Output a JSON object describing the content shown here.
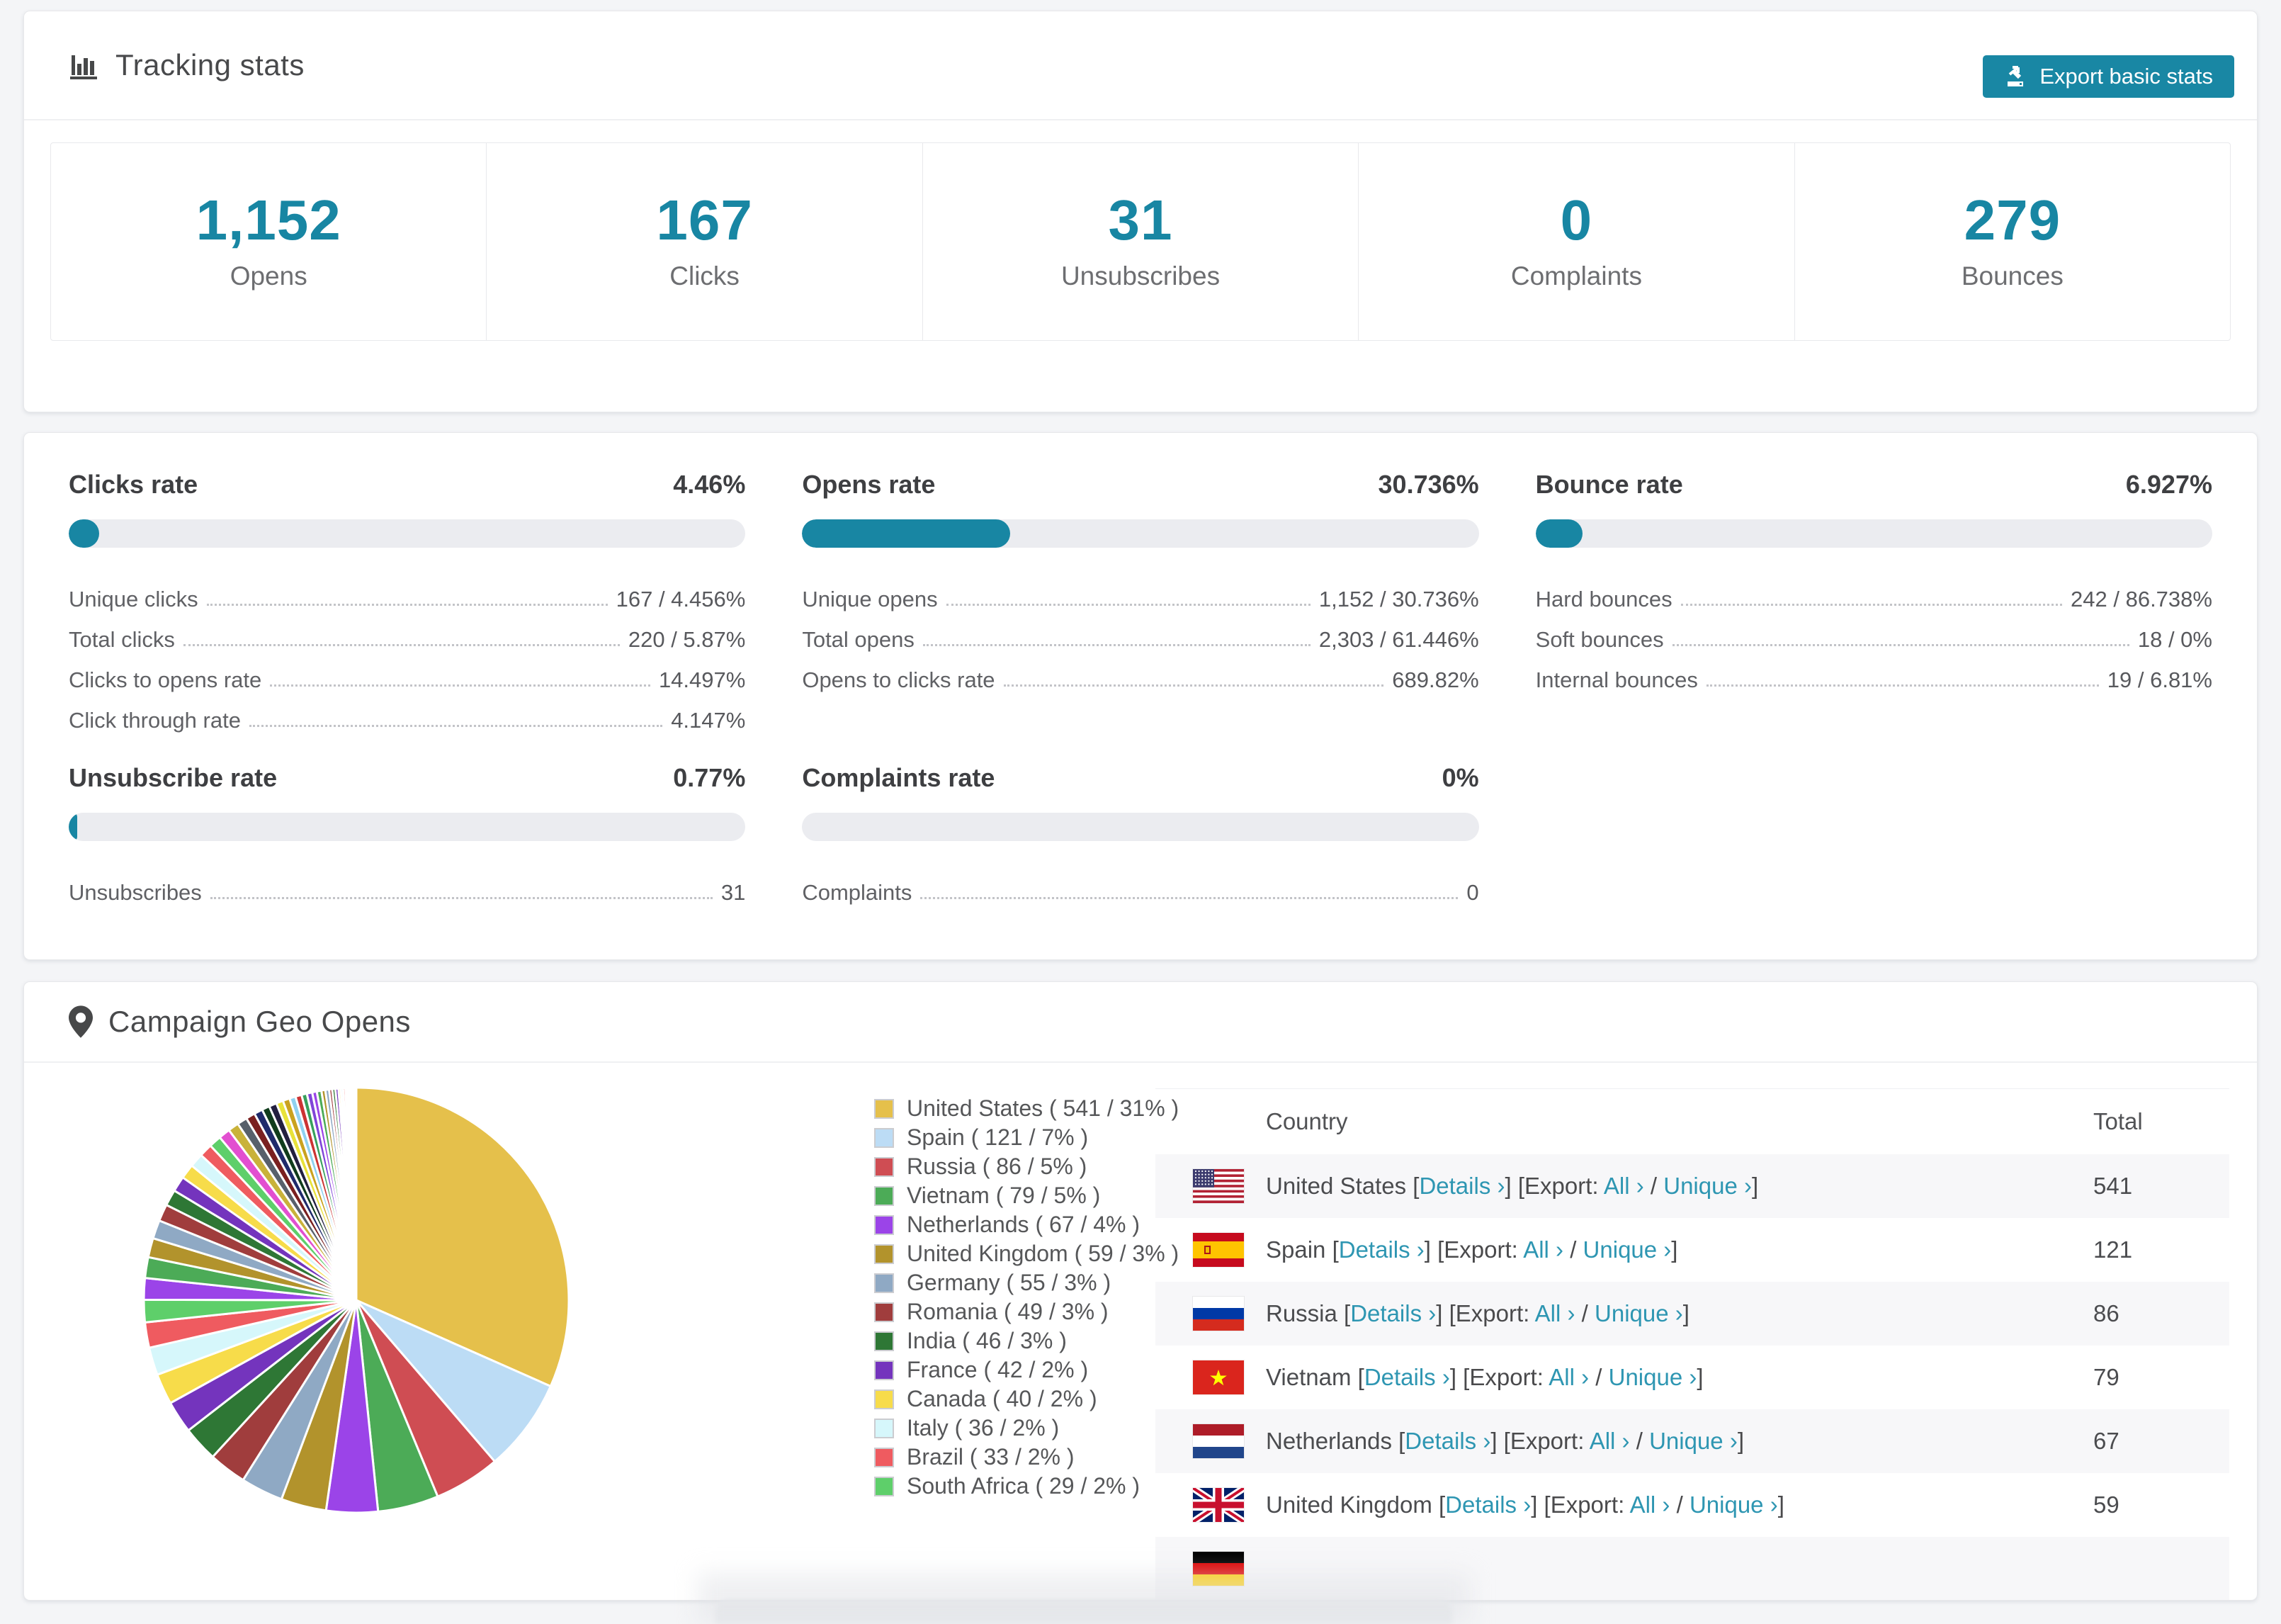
{
  "accent_color": "#1886a3",
  "link_color": "#2e96b2",
  "tracking": {
    "title": "Tracking stats",
    "icon": "bar-chart-icon",
    "export_button": "Export basic stats",
    "stats": [
      {
        "value": "1,152",
        "label": "Opens"
      },
      {
        "value": "167",
        "label": "Clicks"
      },
      {
        "value": "31",
        "label": "Unsubscribes"
      },
      {
        "value": "0",
        "label": "Complaints"
      },
      {
        "value": "279",
        "label": "Bounces"
      }
    ]
  },
  "rates": {
    "blocks": [
      {
        "title": "Clicks rate",
        "value": "4.46%",
        "bar_pct": 4.46,
        "rows": [
          [
            "Unique clicks",
            "167 / 4.456%"
          ],
          [
            "Total clicks",
            "220 / 5.87%"
          ],
          [
            "Clicks to opens rate",
            "14.497%"
          ],
          [
            "Click through rate",
            "4.147%"
          ]
        ]
      },
      {
        "title": "Opens rate",
        "value": "30.736%",
        "bar_pct": 30.736,
        "rows": [
          [
            "Unique opens",
            "1,152 / 30.736%"
          ],
          [
            "Total opens",
            "2,303 / 61.446%"
          ],
          [
            "Opens to clicks rate",
            "689.82%"
          ]
        ]
      },
      {
        "title": "Bounce rate",
        "value": "6.927%",
        "bar_pct": 6.927,
        "rows": [
          [
            "Hard bounces",
            "242 / 86.738%"
          ],
          [
            "Soft bounces",
            "18 / 0%"
          ],
          [
            "Internal bounces",
            "19 / 6.81%"
          ]
        ]
      },
      {
        "title": "Unsubscribe rate",
        "value": "0.77%",
        "bar_pct": 0.77,
        "rows": [
          [
            "Unsubscribes",
            "31"
          ]
        ]
      },
      {
        "title": "Complaints rate",
        "value": "0%",
        "bar_pct": 0,
        "rows": [
          [
            "Complaints",
            "0"
          ]
        ]
      }
    ]
  },
  "geo": {
    "title": "Campaign Geo Opens",
    "icon": "map-pin-icon",
    "table_headers": {
      "country": "Country",
      "total": "Total"
    },
    "link_labels": {
      "open_bracket": "[",
      "close_bracket": "]",
      "details": "Details ›",
      "export_prefix": "[Export:",
      "all": "All ›",
      "slash": "/",
      "unique": "Unique ›"
    },
    "rows": [
      {
        "country": "United States",
        "flag": "us",
        "total": "541"
      },
      {
        "country": "Spain",
        "flag": "es",
        "total": "121"
      },
      {
        "country": "Russia",
        "flag": "ru",
        "total": "86"
      },
      {
        "country": "Vietnam",
        "flag": "vn",
        "total": "79"
      },
      {
        "country": "Netherlands",
        "flag": "nl",
        "total": "67"
      },
      {
        "country": "United Kingdom",
        "flag": "gb",
        "total": "59"
      },
      {
        "country": "",
        "flag": "de",
        "total": "",
        "partial": true
      }
    ]
  },
  "chart_data": {
    "type": "pie",
    "title": "Campaign Geo Opens",
    "legend_position": "right",
    "start_angle_deg": 0,
    "direction": "clockwise",
    "series": [
      {
        "name": "United States",
        "value": 541,
        "pct": "31%",
        "color": "#e5c04b"
      },
      {
        "name": "Spain",
        "value": 121,
        "pct": "7%",
        "color": "#bcdcf5"
      },
      {
        "name": "Russia",
        "value": 86,
        "pct": "5%",
        "color": "#cf4d53"
      },
      {
        "name": "Vietnam",
        "value": 79,
        "pct": "5%",
        "color": "#4cab57"
      },
      {
        "name": "Netherlands",
        "value": 67,
        "pct": "4%",
        "color": "#9b44e8"
      },
      {
        "name": "United Kingdom",
        "value": 59,
        "pct": "3%",
        "color": "#b2932c"
      },
      {
        "name": "Germany",
        "value": 55,
        "pct": "3%",
        "color": "#8fa9c4"
      },
      {
        "name": "Romania",
        "value": 49,
        "pct": "3%",
        "color": "#a03d3d"
      },
      {
        "name": "India",
        "value": 46,
        "pct": "3%",
        "color": "#2e7735"
      },
      {
        "name": "France",
        "value": 42,
        "pct": "2%",
        "color": "#7434bd"
      },
      {
        "name": "Canada",
        "value": 40,
        "pct": "2%",
        "color": "#f7dc4a"
      },
      {
        "name": "Italy",
        "value": 36,
        "pct": "2%",
        "color": "#d6f7fb"
      },
      {
        "name": "Brazil",
        "value": 33,
        "pct": "2%",
        "color": "#ef5b60"
      },
      {
        "name": "South Africa",
        "value": 29,
        "pct": "2%",
        "color": "#5ecf6a"
      }
    ],
    "others": {
      "note": "remaining unlabeled countries shown as thin unlabeled slices",
      "values": [
        28,
        27,
        25,
        24,
        22,
        21,
        20,
        19,
        18,
        17,
        16,
        15,
        14,
        13,
        12,
        11,
        10,
        10,
        9,
        9,
        8,
        8,
        7,
        7,
        6,
        6,
        5,
        5,
        4,
        4,
        4,
        3,
        3,
        3,
        2,
        2,
        2,
        2,
        1,
        1,
        1,
        1,
        1,
        1
      ],
      "palette": [
        "#9b44e8",
        "#4cab57",
        "#b2932c",
        "#8fa9c4",
        "#a03d3d",
        "#2e7735",
        "#7434bd",
        "#f7dc4a",
        "#d6f7fb",
        "#ef5b60",
        "#5ecf6a",
        "#e24fd0",
        "#c9b23a",
        "#57606b",
        "#7a2020",
        "#1f2a6b",
        "#103c1c",
        "#23203f",
        "#e8e23a",
        "#caa21f",
        "#8fd1f0",
        "#cc3333",
        "#37a05c",
        "#8045d8"
      ]
    }
  }
}
